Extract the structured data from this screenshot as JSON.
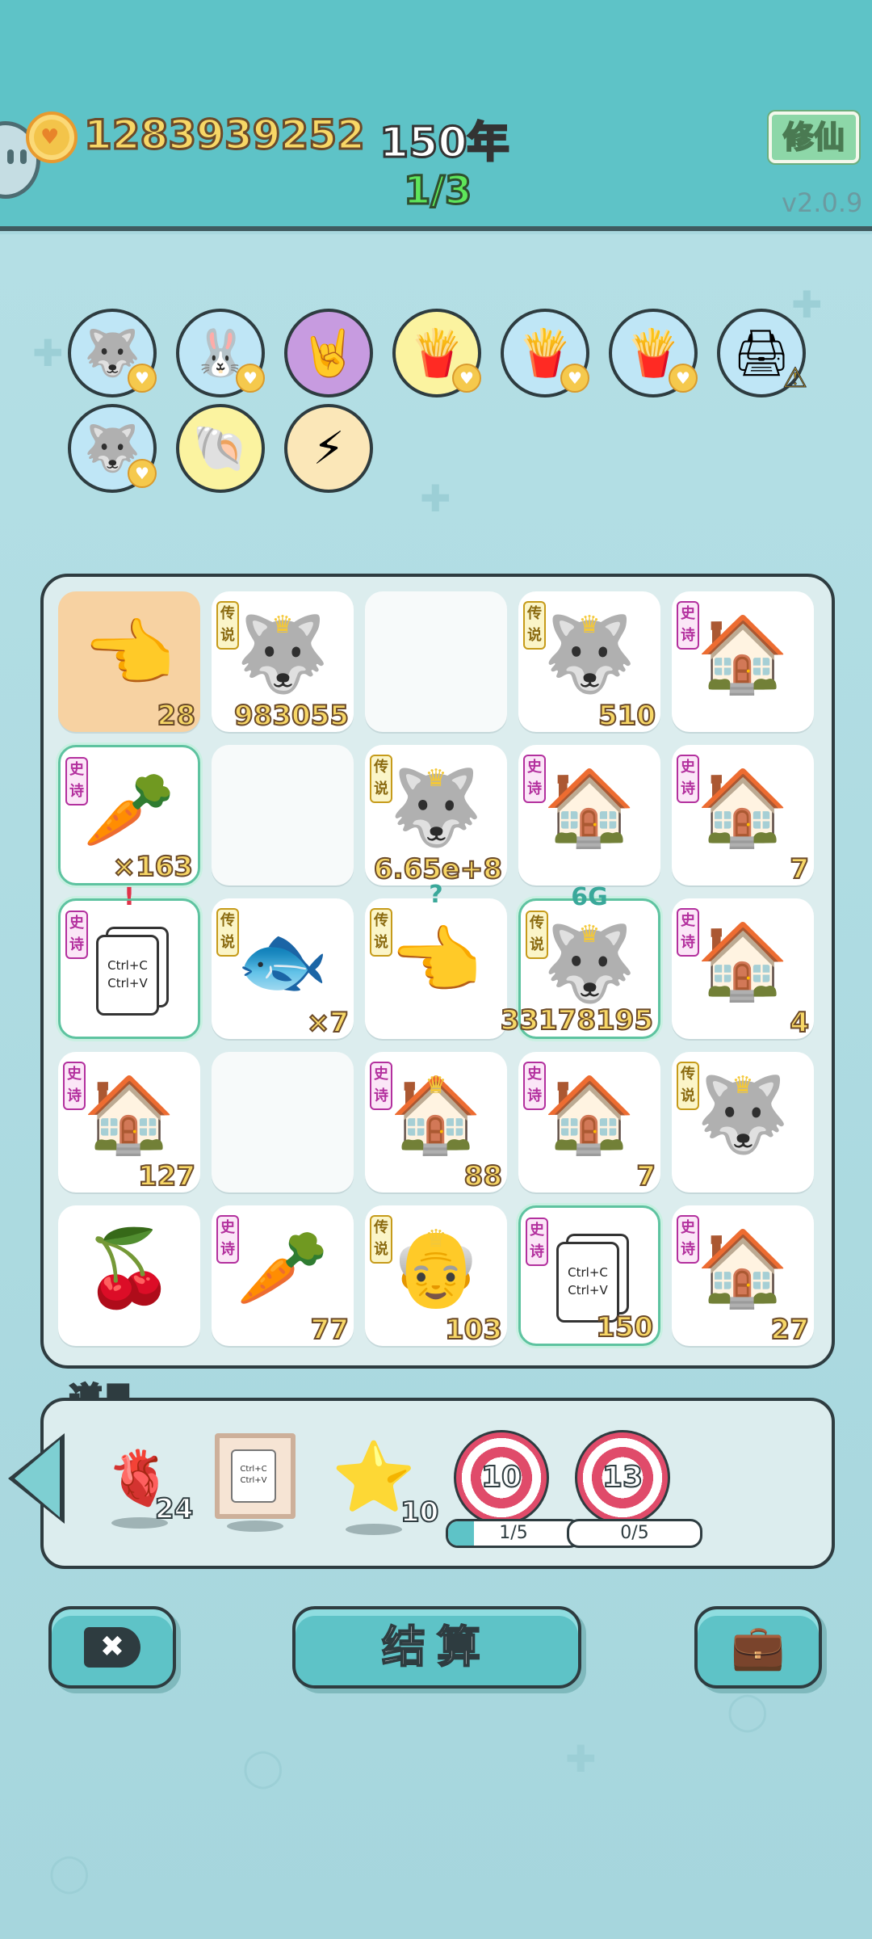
{
  "header": {
    "coins": "1283939252",
    "year": "150年",
    "stage": "1/3",
    "cultivate_label": "修仙",
    "version": "v2.0.9"
  },
  "skills": [
    {
      "name": "husky-skill",
      "glyph": "🐺",
      "bg": "#bfe6f6",
      "badge": "heart"
    },
    {
      "name": "rabbit-skill",
      "glyph": "🐰",
      "bg": "#bfe6f6",
      "badge": "heart"
    },
    {
      "name": "rock-hand-skill",
      "glyph": "🤘",
      "bg": "#c79be0",
      "badge": ""
    },
    {
      "name": "fries-skill",
      "glyph": "🍟",
      "bg": "#fbf3a0",
      "badge": "heart"
    },
    {
      "name": "fries-skill",
      "glyph": "🍟",
      "bg": "#bfe6f6",
      "badge": "heart"
    },
    {
      "name": "fries-skill",
      "glyph": "🍟",
      "bg": "#bfe6f6",
      "badge": "heart"
    },
    {
      "name": "printer-skill",
      "glyph": "🖨",
      "bg": "#bfe6f6",
      "badge": "warn"
    },
    {
      "name": "husky-skill",
      "glyph": "🐺",
      "bg": "#bfe6f6",
      "badge": "heart"
    },
    {
      "name": "shell-skill",
      "glyph": "🐚",
      "bg": "#fbf3a0",
      "badge": ""
    },
    {
      "name": "lightning-skill",
      "glyph": "⚡",
      "bg": "#fbe7b8",
      "badge": ""
    }
  ],
  "tags": {
    "epic": "史诗",
    "legend": "传说"
  },
  "board": [
    {
      "type": "hand-point",
      "glyph": "👈",
      "tag": "",
      "count": "28",
      "style": "orange"
    },
    {
      "type": "husky-king",
      "glyph": "🐺",
      "tag": "legend",
      "count": "983055",
      "crown": true
    },
    {
      "type": "empty",
      "glyph": "",
      "tag": "",
      "count": "",
      "style": "empty"
    },
    {
      "type": "husky-king",
      "glyph": "🐺",
      "tag": "legend",
      "count": "510",
      "crown": true
    },
    {
      "type": "rabbit-house",
      "glyph": "🏠",
      "tag": "epic",
      "count": ""
    },
    {
      "type": "carrot",
      "glyph": "🥕",
      "tag": "epic",
      "count": "×163",
      "style": "glow"
    },
    {
      "type": "empty",
      "glyph": "",
      "tag": "",
      "count": "",
      "style": "empty"
    },
    {
      "type": "husky-king",
      "glyph": "🐺",
      "tag": "legend",
      "count": "6.65e+8",
      "crown": true
    },
    {
      "type": "rabbit-house",
      "glyph": "🏠",
      "tag": "epic",
      "count": ""
    },
    {
      "type": "rabbit-house",
      "glyph": "🏠",
      "tag": "epic",
      "count": "7"
    },
    {
      "type": "copy-paste",
      "glyph": "📋",
      "tag": "epic",
      "count": "",
      "style": "glow",
      "over": "!",
      "overColor": "#e0334a",
      "card_text": "Ctrl+C\nCtrl+V"
    },
    {
      "type": "fish",
      "glyph": "🐟",
      "tag": "legend",
      "count": "×7"
    },
    {
      "type": "hand-point",
      "glyph": "👈",
      "tag": "legend",
      "count": "",
      "over": "?",
      "overColor": "#3aa89a"
    },
    {
      "type": "husky-king",
      "glyph": "🐺",
      "tag": "legend",
      "count": "33178195",
      "crown": true,
      "style": "glow",
      "over": "6G",
      "overColor": "#3aa89a"
    },
    {
      "type": "rabbit-house",
      "glyph": "🏠",
      "tag": "epic",
      "count": "4"
    },
    {
      "type": "rabbit-house",
      "glyph": "🏠",
      "tag": "epic",
      "count": "127"
    },
    {
      "type": "empty",
      "glyph": "",
      "tag": "",
      "count": "",
      "style": "empty"
    },
    {
      "type": "rabbit-house-king",
      "glyph": "🏠",
      "tag": "epic",
      "count": "88",
      "crown": true
    },
    {
      "type": "rabbit-house",
      "glyph": "🏠",
      "tag": "epic",
      "count": "7"
    },
    {
      "type": "husky-king",
      "glyph": "🐺",
      "tag": "legend",
      "count": "",
      "crown": true
    },
    {
      "type": "cherry",
      "glyph": "🍒",
      "tag": "",
      "count": ""
    },
    {
      "type": "carrot",
      "glyph": "🥕",
      "tag": "epic",
      "count": "77"
    },
    {
      "type": "old-man-king",
      "glyph": "👴",
      "tag": "legend",
      "count": "103",
      "crown": true
    },
    {
      "type": "copy-paste",
      "glyph": "📋",
      "tag": "epic",
      "count": "150",
      "style": "glow",
      "card_text": "Ctrl+C\nCtrl+V"
    },
    {
      "type": "rabbit-house",
      "glyph": "🏠",
      "tag": "epic",
      "count": "27"
    }
  ],
  "items": {
    "title": "道具",
    "liver": {
      "glyph": "🫀",
      "count": "24"
    },
    "frame": {
      "text": "Ctrl+C\nCtrl+V"
    },
    "star": {
      "glyph": "⭐",
      "count": "10"
    },
    "target1": {
      "value": "10",
      "progress_text": "1/5",
      "progress": 0.2
    },
    "target2": {
      "value": "13",
      "progress_text": "0/5",
      "progress": 0
    }
  },
  "buttons": {
    "close_glyph": "✖",
    "settle_label": "结算",
    "bag_glyph": "💼"
  }
}
